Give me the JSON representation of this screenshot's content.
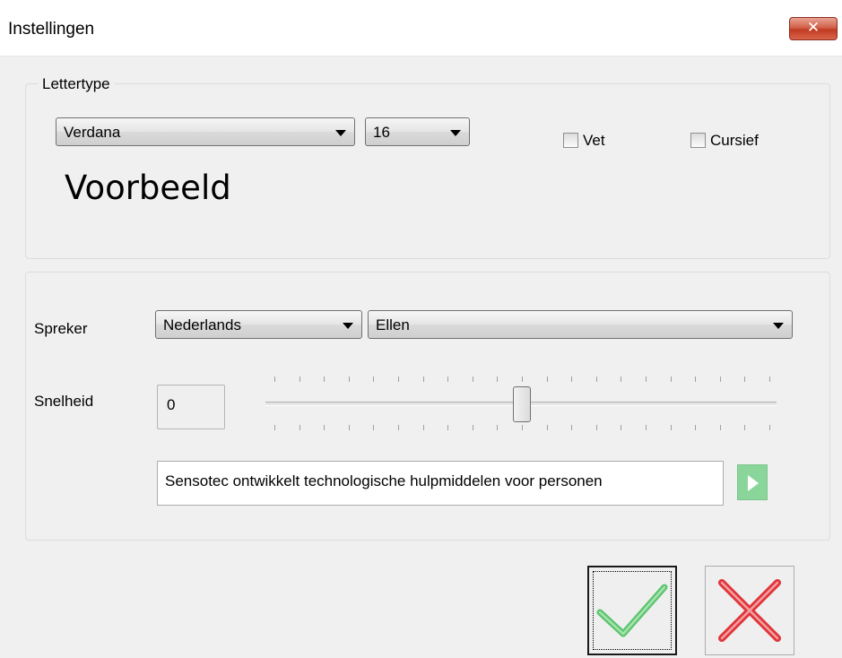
{
  "window": {
    "title": "Instellingen",
    "close_glyph": "✕"
  },
  "font_group": {
    "legend": "Lettertype",
    "font_family": {
      "value": "Verdana"
    },
    "font_size": {
      "value": "16"
    },
    "bold": {
      "label": "Vet",
      "checked": false
    },
    "italic": {
      "label": "Cursief",
      "checked": false
    },
    "preview_text": "Voorbeeld"
  },
  "speech_group": {
    "speaker_label": "Spreker",
    "language": {
      "value": "Nederlands"
    },
    "voice": {
      "value": "Ellen"
    },
    "speed_label": "Snelheid",
    "speed_value": "0",
    "speed_slider": {
      "min": -10,
      "max": 10,
      "value": 0,
      "ticks": 21
    },
    "sample_text": "Sensotec ontwikkelt technologische hulpmiddelen voor personen",
    "play_icon": "play-icon"
  },
  "buttons": {
    "ok_icon": "checkmark-icon",
    "cancel_icon": "cross-icon"
  },
  "colors": {
    "ok_green": "#5cc46e",
    "cancel_red": "#e0353a",
    "play_green": "#8ad69a",
    "close_red": "#c13b22"
  }
}
